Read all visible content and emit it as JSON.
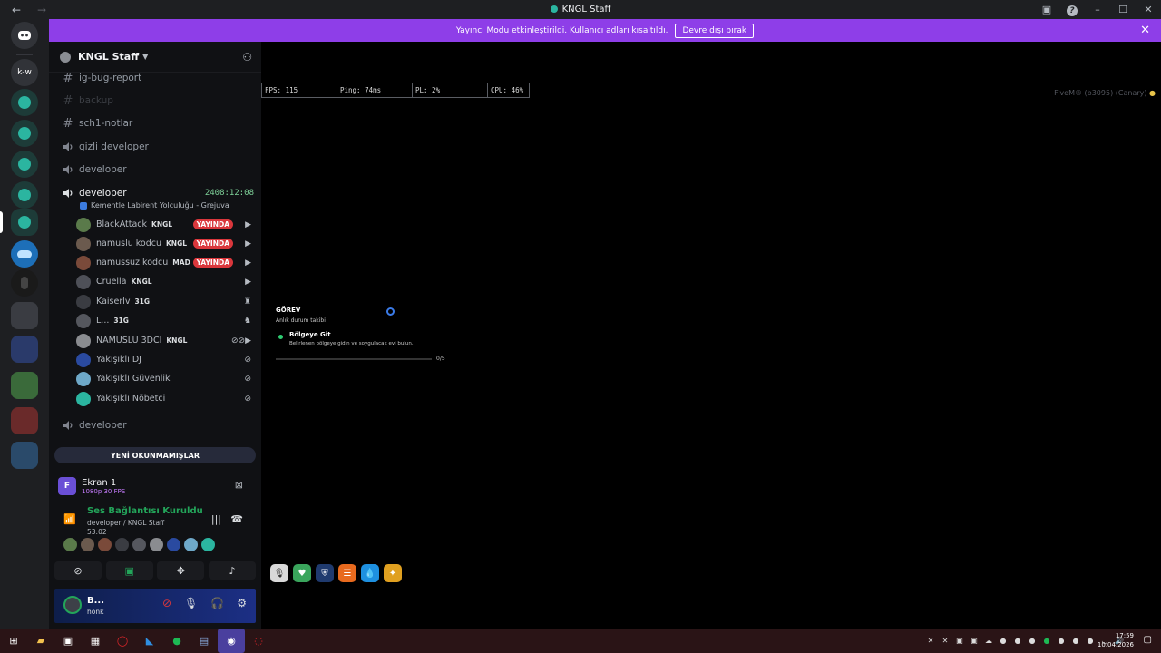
{
  "titlebar": {
    "title": "KNGL Staff",
    "back": "←",
    "forward": "→"
  },
  "banner": {
    "message": "Yayıncı Modu etkinleştirildi. Kullanıcı adları kısaltıldı.",
    "button": "Devre dışı bırak"
  },
  "rail": {
    "home_label": "Discord",
    "dm_label": "k-w"
  },
  "guild": {
    "name": "KNGL Staff"
  },
  "channels": [
    {
      "type": "text",
      "name": "ig-bug-report",
      "state": "normal"
    },
    {
      "type": "text",
      "name": "backup",
      "state": "muted"
    },
    {
      "type": "text",
      "name": "sch1-notlar",
      "state": "normal"
    },
    {
      "type": "voice",
      "name": "gizli developer",
      "state": "normal"
    },
    {
      "type": "voice",
      "name": "developer",
      "state": "normal"
    },
    {
      "type": "voice",
      "name": "developer",
      "state": "active",
      "timer": "2408:12:08"
    }
  ],
  "activity": "Kementle Labirent Yolculuğu - Grejuva",
  "voice_users": [
    {
      "name": "BlackAttack",
      "tag": "KNGL",
      "live": "YAYINDA",
      "color": "#5a7a4a"
    },
    {
      "name": "namuslu kodcu",
      "tag": "KNGL",
      "live": "YAYINDA",
      "color": "#6b5a4e"
    },
    {
      "name": "namussuz kodcu",
      "tag": "MAD",
      "live": "YAYINDA",
      "color": "#7a4a3a"
    },
    {
      "name": "Cruella",
      "tag": "KNGL",
      "live": "",
      "color": "#4e5058"
    },
    {
      "name": "Kaiserlv",
      "tag": "31G",
      "live": "",
      "color": "#3a3c42"
    },
    {
      "name": "L...",
      "tag": "31G",
      "live": "",
      "color": "#55575e"
    },
    {
      "name": "NAMUSLU 3DCI",
      "tag": "KNGL",
      "live": "",
      "color": "#8a8c90"
    },
    {
      "name": "Yakışıklı DJ",
      "tag": "",
      "live": "",
      "color": "#2a4aa0"
    },
    {
      "name": "Yakışıklı Güvenlik",
      "tag": "",
      "live": "",
      "color": "#6ea8c8"
    },
    {
      "name": "Yakışıklı Nöbetci",
      "tag": "",
      "live": "",
      "color": "#2bb5a0"
    }
  ],
  "channel_after": {
    "name": "developer"
  },
  "unread_button": "YENİ OKUNMAMIŞLAR",
  "stream": {
    "title": "Ekran 1",
    "quality": "1080p 30 FPS",
    "badge": "F"
  },
  "voice_connection": {
    "status": "Ses Bağlantısı Kuruldu",
    "location": "developer / KNGL Staff",
    "elapsed": "53:02"
  },
  "user": {
    "name": "B...",
    "status": "honk"
  },
  "game": {
    "perf": {
      "fps": "FPS: 115",
      "ping": "Ping: 74ms",
      "pl": "PL: 2%",
      "cpu": "CPU: 46%"
    },
    "fivem": "FiveM® (b3095) (Canary)",
    "task": {
      "header": "GÖREV",
      "sub": "Anlık durum takibi",
      "objective": "Bölgeye Git",
      "objective_desc": "Belirlenen bölgeye gidin ve soygulacak evi bulun.",
      "count": "0/5"
    }
  },
  "hud_colors": [
    "#d9d9d9",
    "#3aa55c",
    "#1f3a6e",
    "#e86a1e",
    "#1e90e0",
    "#e0a020"
  ],
  "taskbar": {
    "time": "17:59",
    "date": "10.04.2026"
  }
}
